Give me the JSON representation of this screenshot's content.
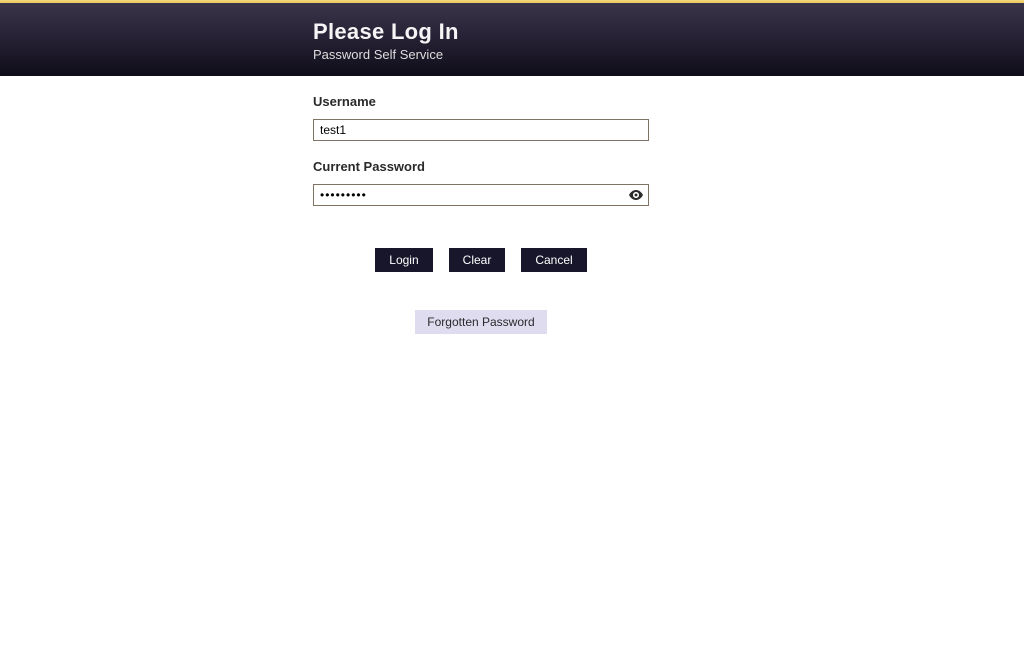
{
  "header": {
    "title": "Please Log In",
    "subtitle": "Password Self Service"
  },
  "form": {
    "username_label": "Username",
    "username_value": "test1",
    "password_label": "Current Password",
    "password_value": "•••••••••",
    "eye_icon": "eye-icon"
  },
  "buttons": {
    "login": "Login",
    "clear": "Clear",
    "cancel": "Cancel",
    "forgot": "Forgotten Password"
  }
}
